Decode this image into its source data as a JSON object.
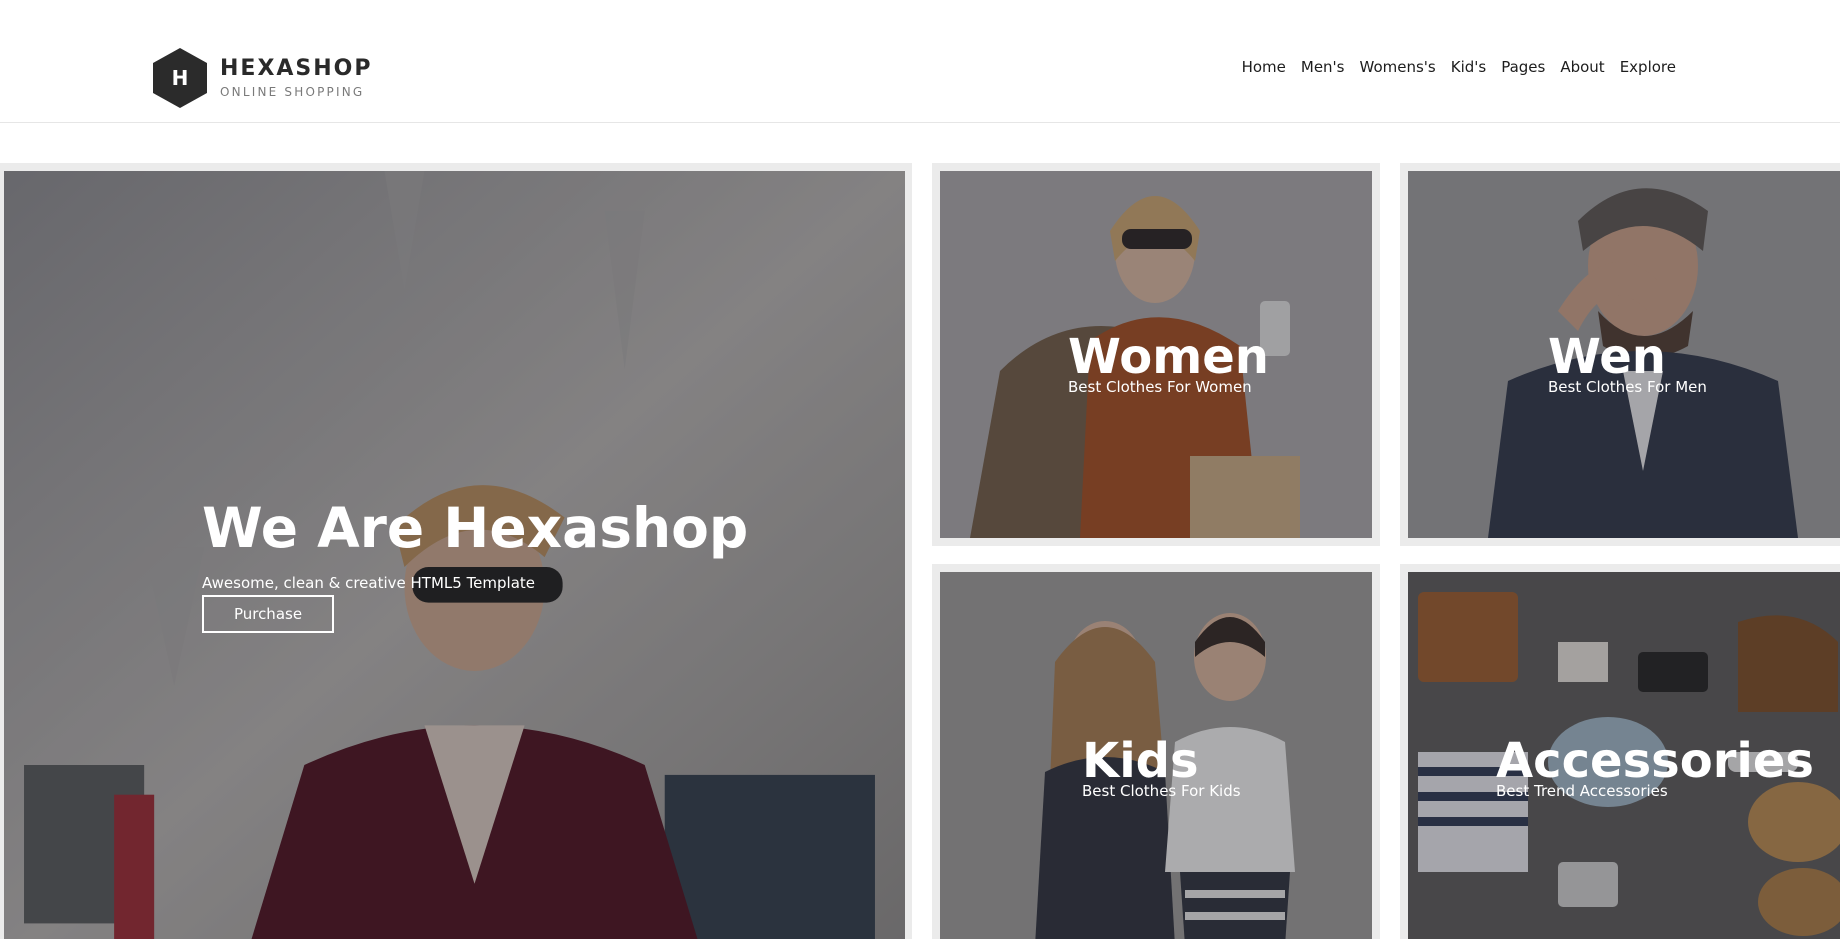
{
  "brand": {
    "letter": "H",
    "name": "HEXASHOP",
    "tagline": "ONLINE SHOPPING"
  },
  "nav": {
    "items": [
      "Home",
      "Men's",
      "Womens's",
      "Kid's",
      "Pages",
      "About",
      "Explore"
    ]
  },
  "hero": {
    "title": "We Are Hexashop",
    "subtitle": "Awesome, clean & creative HTML5 Template",
    "button_label": "Purchase"
  },
  "categories": [
    {
      "title": "Women",
      "subtitle": "Best Clothes For Women"
    },
    {
      "title": "Wen",
      "subtitle": "Best Clothes For Men"
    },
    {
      "title": "Kids",
      "subtitle": "Best Clothes For Kids"
    },
    {
      "title": "Accessories",
      "subtitle": "Best Trend Accessories"
    }
  ],
  "colors": {
    "logo_bg": "#2b2b2b",
    "tile_border": "#ebebeb",
    "text_on_image": "#ffffff"
  }
}
